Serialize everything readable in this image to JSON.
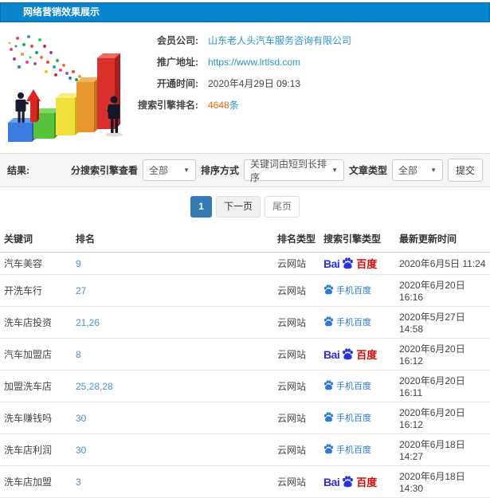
{
  "page": {
    "title": "网络营销效果展示"
  },
  "info": {
    "company_label": "会员公司:",
    "company_value": "山东老人头汽车服务咨询有限公司",
    "url_label": "推广地址:",
    "url_value": "https://www.lrtlsd.com",
    "open_time_label": "开通时间:",
    "open_time_value": "2020年4月29日 09:13",
    "rank_label": "搜索引擎排名:",
    "rank_count": "4648",
    "rank_unit": "条"
  },
  "filters": {
    "result_label": "结果:",
    "engine_view_label": "分搜索引擎查看",
    "engine_view_value": "全部",
    "sort_label": "排序方式",
    "sort_value": "关键词由短到长排序",
    "article_type_label": "文章类型",
    "article_type_value": "全部",
    "submit_label": "提交"
  },
  "pagination": {
    "current": "1",
    "next": "下一页",
    "last": "尾页"
  },
  "table": {
    "headers": [
      "关键词",
      "排名",
      "排名类型",
      "搜索引擎类型",
      "最新更新时间"
    ],
    "rows": [
      {
        "keyword": "汽车美容",
        "rank": "9",
        "rank_type": "云网站",
        "engine": "baidu",
        "updated": "2020年6月5日 11:24"
      },
      {
        "keyword": "开洗车行",
        "rank": "27",
        "rank_type": "云网站",
        "engine": "mobile_baidu",
        "updated": "2020年6月20日 16:16"
      },
      {
        "keyword": "洗车店投资",
        "rank": "21,26",
        "rank_type": "云网站",
        "engine": "mobile_baidu",
        "updated": "2020年5月27日 14:58"
      },
      {
        "keyword": "汽车加盟店",
        "rank": "8",
        "rank_type": "云网站",
        "engine": "baidu",
        "updated": "2020年6月20日 16:12"
      },
      {
        "keyword": "加盟洗车店",
        "rank": "25,28,28",
        "rank_type": "云网站",
        "engine": "mobile_baidu",
        "updated": "2020年6月20日 16:11"
      },
      {
        "keyword": "洗车赚钱吗",
        "rank": "30",
        "rank_type": "云网站",
        "engine": "mobile_baidu",
        "updated": "2020年6月20日 16:12"
      },
      {
        "keyword": "洗车店利润",
        "rank": "30",
        "rank_type": "云网站",
        "engine": "mobile_baidu",
        "updated": "2020年6月18日 14:27"
      },
      {
        "keyword": "洗车店加盟",
        "rank": "3",
        "rank_type": "云网站",
        "engine": "baidu",
        "updated": "2020年6月18日 14:30"
      }
    ]
  },
  "icons": {
    "baidu_text_prefix": "Bai",
    "baidu_text_suffix": "百度",
    "baidu_paw": "baidu-paw-icon",
    "mobile_baidu_label": "手机百度",
    "select_caret": "chevron-down-icon"
  },
  "colors": {
    "header_blue": "#0885cd",
    "link_blue": "#2a96d4",
    "rank_orange": "#ff6600",
    "baidu_blue": "#2932e1",
    "baidu_red": "#e10601",
    "pagination_active": "#337ab7"
  }
}
